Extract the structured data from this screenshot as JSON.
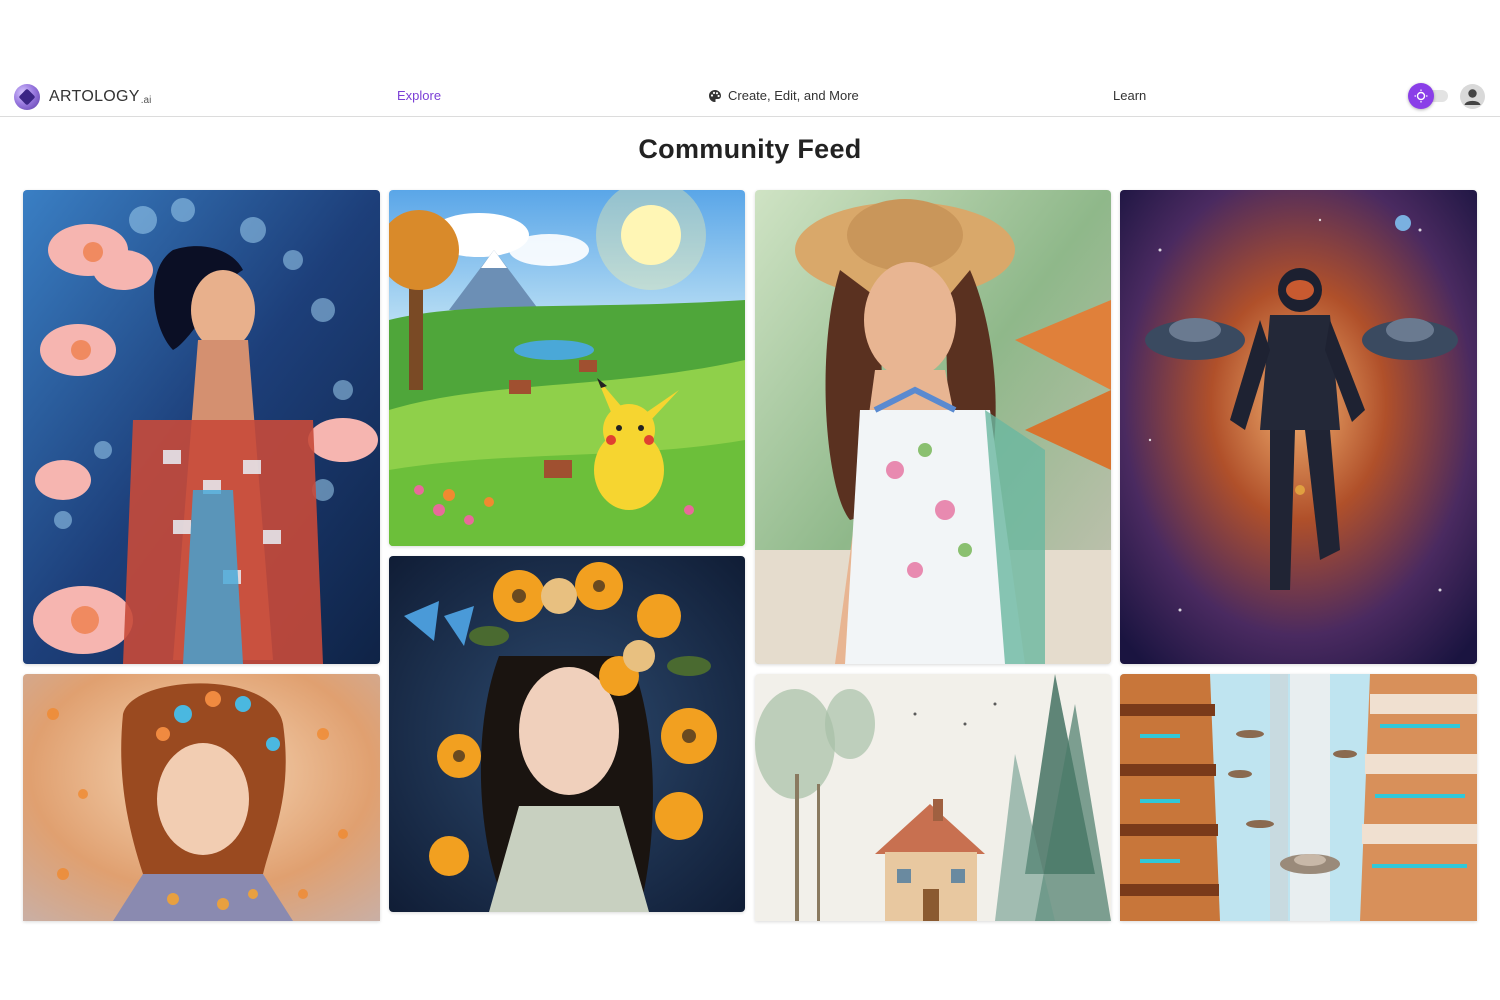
{
  "header": {
    "brand": "ARTOLOGY",
    "brand_suffix": ".ai",
    "nav": {
      "explore": "Explore",
      "create": "Create, Edit, and More",
      "learn": "Learn"
    },
    "theme_toggle_icon": "sun-icon",
    "avatar_icon": "user-icon"
  },
  "main": {
    "title": "Community Feed"
  },
  "colors": {
    "accent": "#7b3fd6",
    "toggle": "#8a3ee8"
  }
}
